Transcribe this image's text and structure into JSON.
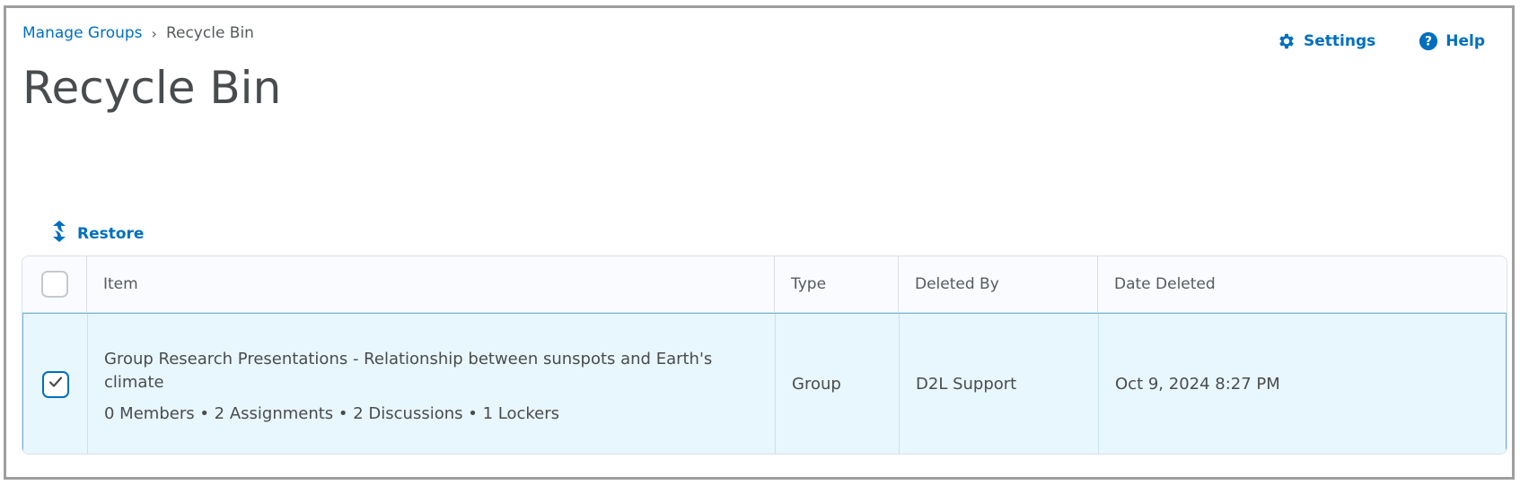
{
  "breadcrumb": {
    "parent": "Manage Groups",
    "separator": "›",
    "current": "Recycle Bin"
  },
  "header_actions": {
    "settings_label": "Settings",
    "help_label": "Help",
    "settings_icon": "gear-icon",
    "help_icon": "question-circle-icon"
  },
  "page": {
    "title": "Recycle Bin"
  },
  "toolbar": {
    "restore_label": "Restore",
    "restore_icon": "restore-arrows-icon"
  },
  "table": {
    "columns": [
      "Item",
      "Type",
      "Deleted By",
      "Date Deleted"
    ],
    "rows": [
      {
        "selected": true,
        "item_title": "Group Research Presentations - Relationship between sunspots and Earth's climate",
        "item_meta": "0 Members • 2 Assignments • 2 Discussions • 1 Lockers",
        "type": "Group",
        "deleted_by": "D2L Support",
        "date_deleted": "Oct 9, 2024 8:27 PM"
      }
    ]
  },
  "colors": {
    "link": "#006fbf",
    "selected_row_bg": "#e8f6fd",
    "selected_row_border": "#6fb7de",
    "text": "#494c4e"
  }
}
